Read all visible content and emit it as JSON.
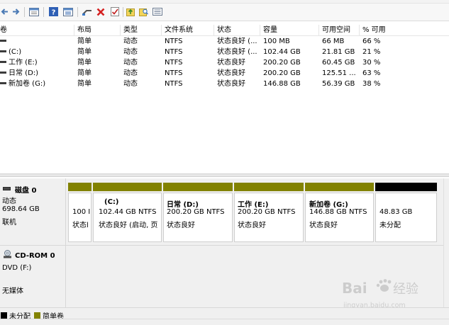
{
  "toolbar": {
    "icons": [
      "back-icon",
      "forward-icon",
      "properties-list-icon",
      "help-icon",
      "help-panel-icon",
      "connect-icon",
      "delete-icon",
      "check-icon",
      "folder-up-icon",
      "folder-search-icon",
      "view-list-icon"
    ]
  },
  "columns": {
    "volume": "卷",
    "layout": "布局",
    "type": "类型",
    "fs": "文件系统",
    "status": "状态",
    "capacity": "容量",
    "free": "可用空间",
    "pct": "% 可用"
  },
  "volumes": [
    {
      "name": "",
      "layout": "简单",
      "type": "动态",
      "fs": "NTFS",
      "status": "状态良好 (...",
      "capacity": "100 MB",
      "free": "66 MB",
      "pct": "66 %"
    },
    {
      "name": "(C:)",
      "layout": "简单",
      "type": "动态",
      "fs": "NTFS",
      "status": "状态良好 (...",
      "capacity": "102.44 GB",
      "free": "21.81 GB",
      "pct": "21 %"
    },
    {
      "name": "工作 (E:)",
      "layout": "简单",
      "type": "动态",
      "fs": "NTFS",
      "status": "状态良好",
      "capacity": "200.20 GB",
      "free": "60.45 GB",
      "pct": "30 %"
    },
    {
      "name": "日常 (D:)",
      "layout": "简单",
      "type": "动态",
      "fs": "NTFS",
      "status": "状态良好",
      "capacity": "200.20 GB",
      "free": "125.51 ...",
      "pct": "63 %"
    },
    {
      "name": "新加卷 (G:)",
      "layout": "简单",
      "type": "动态",
      "fs": "NTFS",
      "status": "状态良好",
      "capacity": "146.88 GB",
      "free": "56.39 GB",
      "pct": "38 %"
    }
  ],
  "disk0": {
    "title": "磁盘 0",
    "type": "动态",
    "size": "698.64 GB",
    "state": "联机",
    "partitions": [
      {
        "name": "",
        "size": "100 I",
        "status": "状态l",
        "kind": "simple"
      },
      {
        "name": "(C:)",
        "size": "102.44 GB NTFS",
        "status": "状态良好 (启动, 页",
        "kind": "simple"
      },
      {
        "name": "日常  (D:)",
        "size": "200.20 GB NTFS",
        "status": "状态良好",
        "kind": "simple"
      },
      {
        "name": "工作  (E:)",
        "size": "200.20 GB NTFS",
        "status": "状态良好",
        "kind": "simple"
      },
      {
        "name": "新加卷  (G:)",
        "size": "146.88 GB NTFS",
        "status": "状态良好",
        "kind": "simple"
      },
      {
        "name": "",
        "size": "48.83 GB",
        "status": "未分配",
        "kind": "unallocated"
      }
    ]
  },
  "cdrom0": {
    "title": "CD-ROM 0",
    "drive": "DVD (F:)",
    "media": "无媒体"
  },
  "legend": {
    "unallocated": "未分配",
    "simple_volume": "简单卷"
  },
  "colors": {
    "simple_volume": "#828200",
    "unallocated": "#000000"
  },
  "watermark": {
    "brand": "Bai",
    "brand_cn": "经验",
    "domain": "jingyan.baidu.com"
  }
}
